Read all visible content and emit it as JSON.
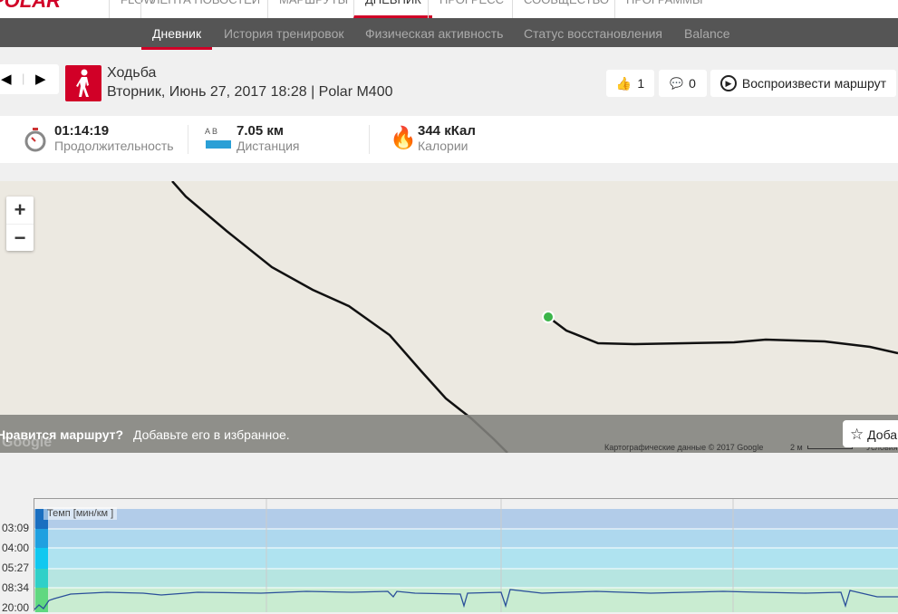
{
  "topnav": {
    "logo": "POLAR",
    "items": [
      "FLOW",
      "ЛЕНТА НОВОСТЕЙ",
      "МАРШРУТЫ",
      "ДНЕВНИК",
      "ПРОГРЕСС",
      "СООБЩЕСТВО",
      "ПРОГРАММЫ"
    ]
  },
  "subnav": [
    "Дневник",
    "История тренировок",
    "Физическая активность",
    "Статус восстановления",
    "Balance"
  ],
  "session": {
    "sport": "Ходьба",
    "subtitle": "Вторник, Июнь 27, 2017 18:28 | Polar M400"
  },
  "actions": {
    "likes": "1",
    "comments": "0",
    "replay": "Воспроизвести маршрут"
  },
  "stats": {
    "duration": "01:14:19",
    "duration_label": "Продолжительность",
    "distance": "7.05 км",
    "distance_label": "Дистанция",
    "ab": "A  B",
    "calories": "344 кКал",
    "calories_label": "Калории"
  },
  "map": {
    "zoom_in": "+",
    "zoom_out": "−",
    "prompt_bold": "Нравится маршрут?",
    "prompt": "Добавьте его в избранное.",
    "add_fav": "Доба",
    "attribution": "Картографические данные © 2017 Google",
    "scale": "2 м",
    "terms": "Условия",
    "google": "Google"
  },
  "chart": {
    "title": "Темп [мин/км ]",
    "y_ticks": [
      "03:09",
      "04:00",
      "05:27",
      "08:34",
      "20:00"
    ]
  }
}
